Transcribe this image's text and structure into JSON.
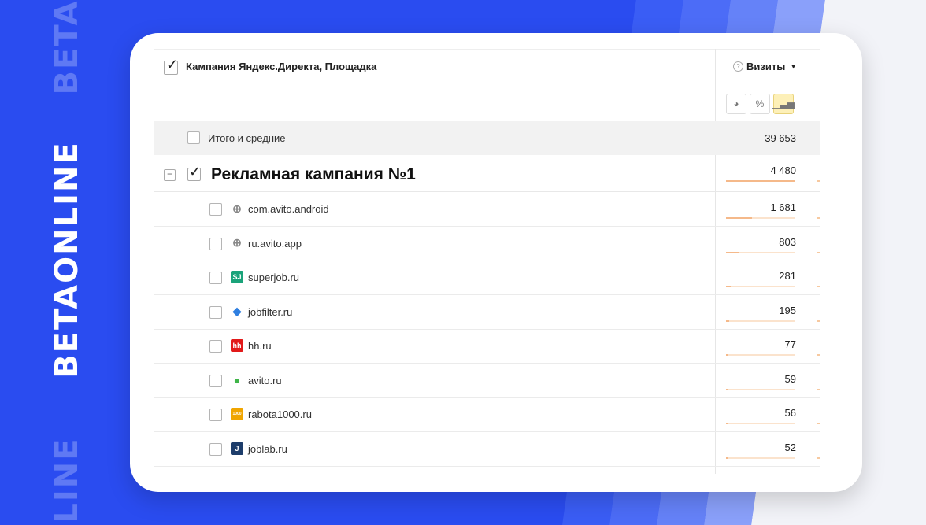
{
  "brand": {
    "text": "BETAONLINE",
    "ghost_top": "BETA",
    "ghost_bottom": "LINE"
  },
  "header": {
    "dimension_title": "Кампания Яндекс.Директа, Площадка",
    "metric_label": "Визиты",
    "metric_caret": "▾",
    "help_icon": "?",
    "tools": [
      {
        "name": "pie-chart-icon",
        "glyph": "◕",
        "active": false
      },
      {
        "name": "percent-icon",
        "glyph": "%",
        "active": false
      },
      {
        "name": "bar-chart-icon",
        "glyph": "▁▃▅",
        "active": true
      }
    ]
  },
  "total": {
    "label": "Итого и средние",
    "value": "39 653"
  },
  "campaign": {
    "collapse_glyph": "−",
    "title": "Рекламная кампания №1",
    "value": "4 480",
    "share": 1.0
  },
  "rows": [
    {
      "label": "com.avito.android",
      "value": "1 681",
      "share": 0.375,
      "icon": "globe-icon",
      "glyph": "⊕",
      "icon_bg": "transparent",
      "icon_fg": "#888888"
    },
    {
      "label": "ru.avito.app",
      "value": "803",
      "share": 0.18,
      "icon": "globe-icon",
      "glyph": "⊕",
      "icon_bg": "transparent",
      "icon_fg": "#888888"
    },
    {
      "label": "superjob.ru",
      "value": "281",
      "share": 0.063,
      "icon": "superjob-logo-icon",
      "glyph": "SJ",
      "icon_bg": "#1aa37a",
      "icon_fg": "#ffffff"
    },
    {
      "label": "jobfilter.ru",
      "value": "195",
      "share": 0.044,
      "icon": "jobfilter-logo-icon",
      "glyph": "◆",
      "icon_bg": "transparent",
      "icon_fg": "#2f7fe0"
    },
    {
      "label": "hh.ru",
      "value": "77",
      "share": 0.017,
      "icon": "hh-logo-icon",
      "glyph": "hh",
      "icon_bg": "#e21a1a",
      "icon_fg": "#ffffff"
    },
    {
      "label": "avito.ru",
      "value": "59",
      "share": 0.013,
      "icon": "avito-logo-icon",
      "glyph": "●",
      "icon_bg": "transparent",
      "icon_fg": "#3fb549"
    },
    {
      "label": "rabota1000.ru",
      "value": "56",
      "share": 0.0125,
      "icon": "rabota1000-logo-icon",
      "glyph": "1000",
      "icon_bg": "#f0a500",
      "icon_fg": "#ffffff"
    },
    {
      "label": "joblab.ru",
      "value": "52",
      "share": 0.0116,
      "icon": "joblab-logo-icon",
      "glyph": "J",
      "icon_bg": "#1d3d6b",
      "icon_fg": "#ffffff"
    }
  ]
}
